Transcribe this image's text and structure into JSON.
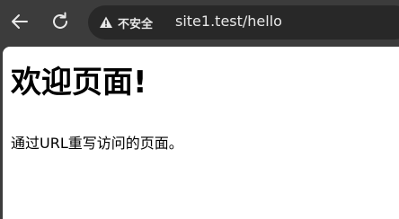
{
  "browser": {
    "back_icon": "arrow-left-icon",
    "reload_icon": "reload-icon",
    "security_icon": "warning-triangle-icon",
    "security_label": "不安全",
    "url": "site1.test/hello"
  },
  "page": {
    "heading": "欢迎页面!",
    "paragraph": "通过URL重写访问的页面。"
  },
  "colors": {
    "toolbar_bg": "#3c3c3c",
    "omnibox_bg": "#282828",
    "toolbar_text": "#e8e8e8",
    "page_bg": "#ffffff",
    "page_text": "#000000"
  }
}
